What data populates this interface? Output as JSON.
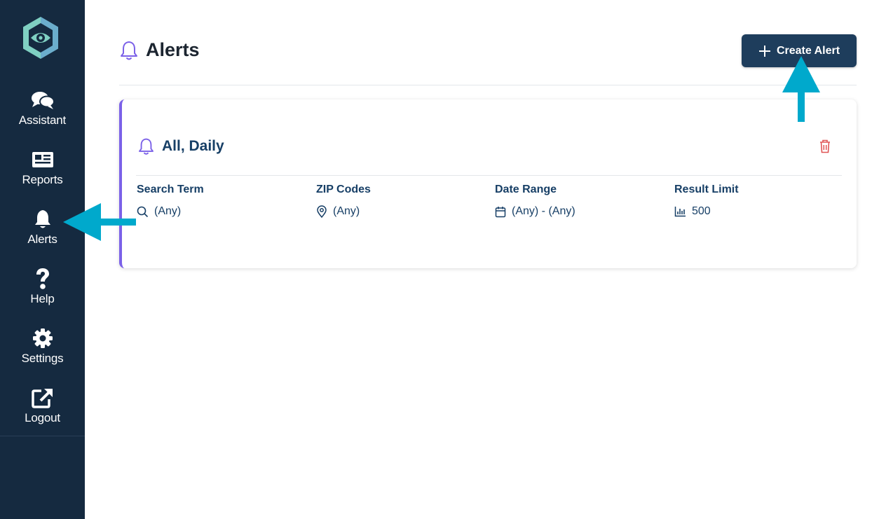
{
  "sidebar": {
    "items": [
      {
        "label": "Assistant",
        "icon": "comments-icon"
      },
      {
        "label": "Reports",
        "icon": "newspaper-icon"
      },
      {
        "label": "Alerts",
        "icon": "bell-icon"
      },
      {
        "label": "Help",
        "icon": "question-icon"
      },
      {
        "label": "Settings",
        "icon": "gear-icon"
      },
      {
        "label": "Logout",
        "icon": "external-link-icon"
      }
    ]
  },
  "header": {
    "title": "Alerts",
    "create_button_label": "Create Alert"
  },
  "alert_card": {
    "title": "All, Daily",
    "fields": [
      {
        "label": "Search Term",
        "value": "(Any)",
        "icon": "search-icon"
      },
      {
        "label": "ZIP Codes",
        "value": "(Any)",
        "icon": "map-pin-icon"
      },
      {
        "label": "Date Range",
        "value": "(Any) - (Any)",
        "icon": "calendar-icon"
      },
      {
        "label": "Result Limit",
        "value": "500",
        "icon": "bar-chart-icon"
      }
    ]
  },
  "colors": {
    "sidebar_bg": "#152a40",
    "accent_purple": "#7b61e8",
    "primary_button": "#1e3d5c",
    "text_navy": "#173f66",
    "delete_red": "#e05555",
    "annotation_arrow": "#00a9cc"
  }
}
